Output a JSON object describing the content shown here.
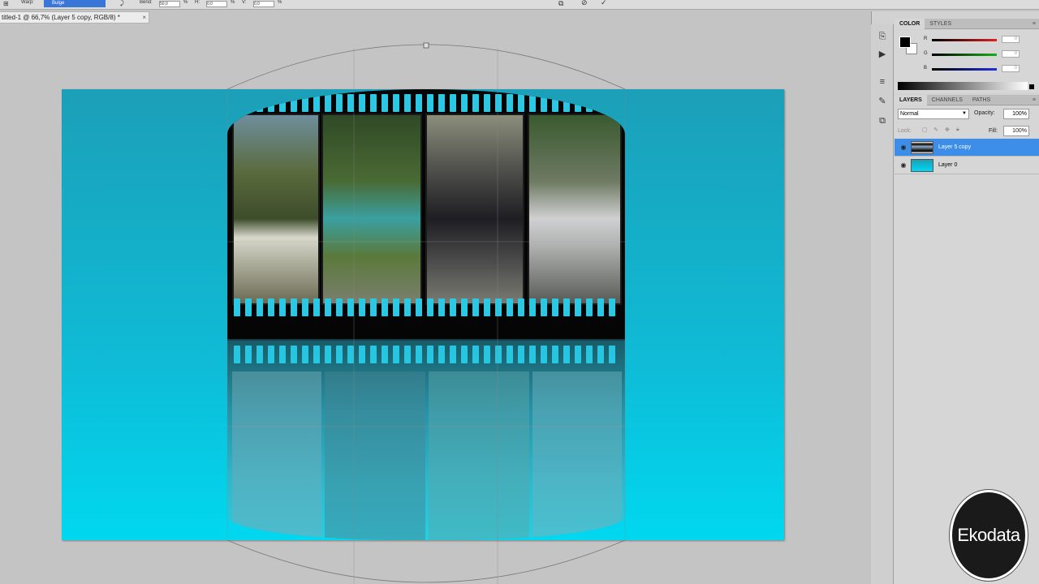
{
  "options_bar": {
    "warp_label": "Warp:",
    "warp_value": "Bulge",
    "bend_label": "Bend:",
    "bend_value": "50,0",
    "h_label": "H:",
    "h_value": "0,0",
    "v_label": "V:",
    "v_value": "0,0",
    "percent": "%"
  },
  "document_tab": {
    "title": "titled-1 @ 66,7% (Layer 5 copy, RGB/8) *",
    "close_glyph": "×"
  },
  "color_panel": {
    "tabs": [
      "COLOR",
      "STYLES"
    ],
    "menu_glyph": "≡",
    "foreground": "#000000",
    "background": "#ffffff",
    "channels": [
      {
        "label": "R",
        "value": "0",
        "color": "#e02020"
      },
      {
        "label": "G",
        "value": "0",
        "color": "#18b018"
      },
      {
        "label": "B",
        "value": "0",
        "color": "#2030d8"
      }
    ]
  },
  "layers_panel": {
    "tabs": [
      "LAYERS",
      "CHANNELS",
      "PATHS"
    ],
    "menu_glyph": "≡",
    "blend_mode": "Normal",
    "opacity_label": "Opacity:",
    "opacity_value": "100%",
    "lock_label": "Lock:",
    "fill_label": "Fill:",
    "fill_value": "100%",
    "layers": [
      {
        "name": "Layer 5 copy",
        "selected": true,
        "visible": true
      },
      {
        "name": "Layer 0",
        "selected": false,
        "visible": true
      }
    ]
  },
  "watermark": {
    "text": "Ekodata"
  },
  "colors": {
    "accent_selection": "#3d8ee8",
    "canvas_gradient_top": "#1c9fb8",
    "canvas_gradient_bottom": "#00d8f0",
    "film_perforation": "#2cc8e3"
  }
}
